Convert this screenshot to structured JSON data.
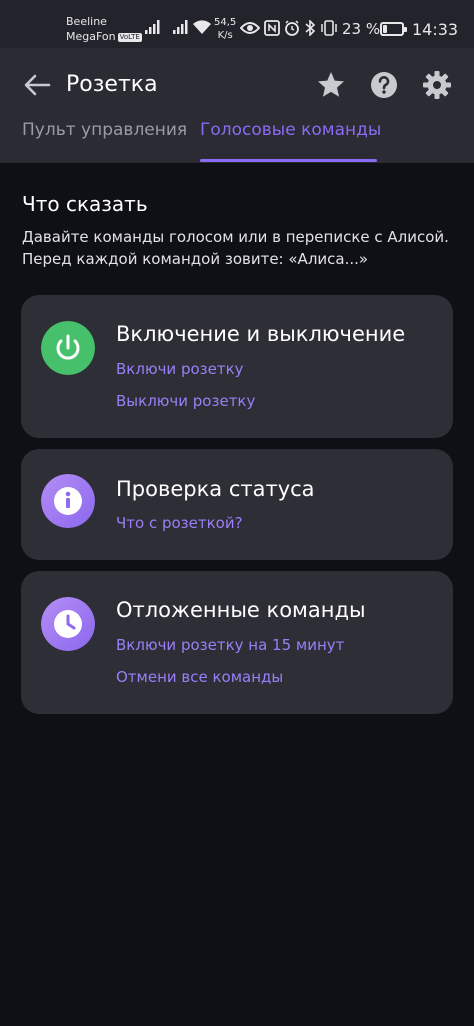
{
  "status_bar": {
    "carrier_1": "Beeline",
    "carrier_2": "MegaFon",
    "volte_badge": "VoLTE",
    "speed_value": "54,5",
    "speed_unit": "K/s",
    "battery_percent": "23 %",
    "battery_level": 0.23,
    "time": "14:33",
    "icons": [
      "signal-icon",
      "signal-icon",
      "wifi-icon",
      "eye-icon",
      "nfc-icon",
      "alarm-icon",
      "bluetooth-icon",
      "vibrate-icon",
      "battery-icon"
    ]
  },
  "header": {
    "title": "Розетка",
    "icons": [
      "back-arrow-icon",
      "star-icon",
      "help-icon",
      "gear-icon"
    ],
    "tabs": [
      {
        "label": "Пульт управления",
        "active": false
      },
      {
        "label": "Голосовые команды",
        "active": true
      }
    ],
    "accent_color": "#8b6bf5"
  },
  "main": {
    "section_title": "Что сказать",
    "section_description": "Давайте команды голосом или в переписке с Алисой. Перед каждой командой зовите: «Алиса...»",
    "cards": [
      {
        "title": "Включение и выключение",
        "icon": "power-icon",
        "icon_color": "#46c06a",
        "commands": [
          "Включи розетку",
          "Выключи розетку"
        ]
      },
      {
        "title": "Проверка статуса",
        "icon": "info-icon",
        "icon_color": "#a07cf0",
        "commands": [
          "Что с розеткой?"
        ]
      },
      {
        "title": "Отложенные команды",
        "icon": "clock-icon",
        "icon_color": "#a07cf0",
        "commands": [
          "Включи розетку на 15 минут",
          "Отмени все команды"
        ]
      }
    ]
  }
}
